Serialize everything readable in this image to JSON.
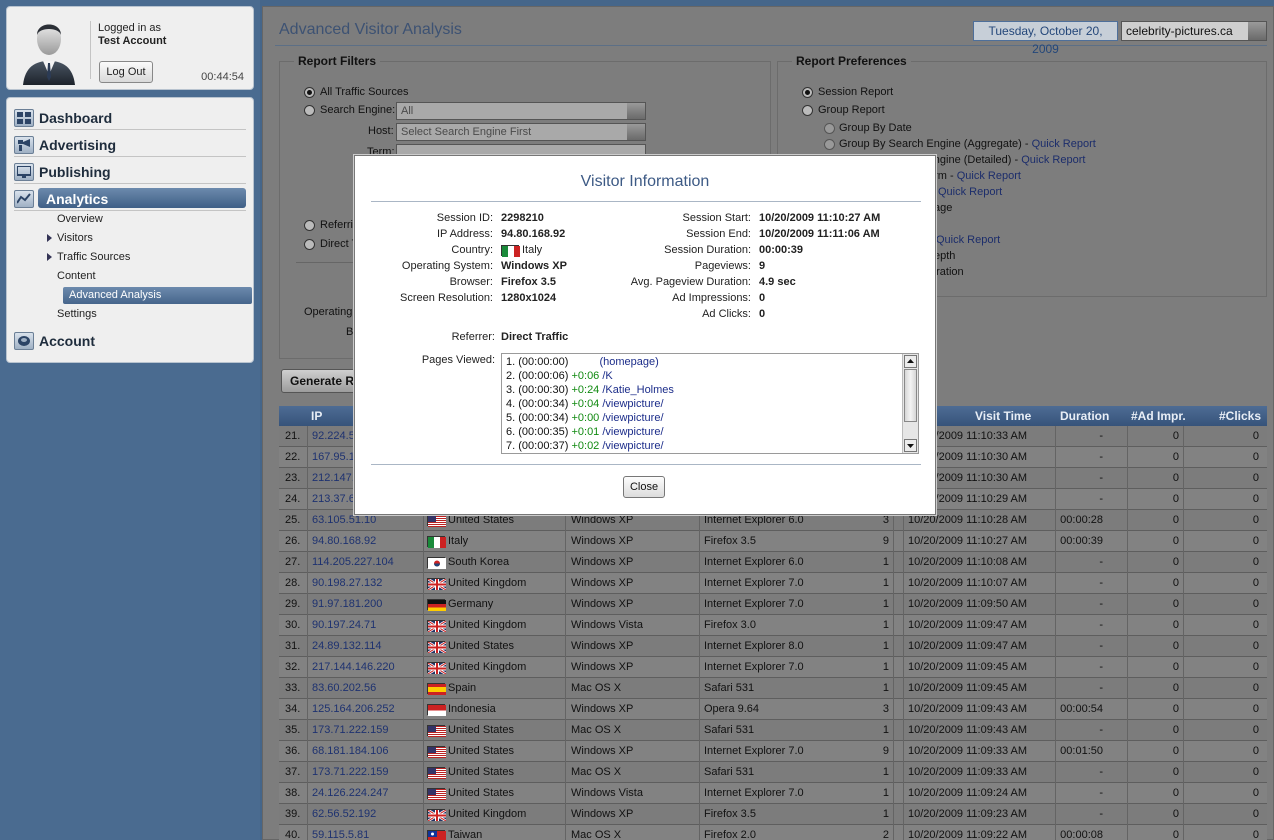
{
  "user": {
    "logged_in_label": "Logged in as",
    "account_name": "Test Account",
    "logout_label": "Log Out",
    "session_time": "00:44:54"
  },
  "nav": {
    "dashboard": "Dashboard",
    "advertising": "Advertising",
    "publishing": "Publishing",
    "analytics": "Analytics",
    "account": "Account",
    "analytics_sub": [
      "Overview",
      "Visitors",
      "Traffic Sources",
      "Content",
      "Advanced Analysis",
      "Settings"
    ]
  },
  "header": {
    "title": "Advanced Visitor Analysis",
    "date": "Tuesday, October 20, 2009",
    "site": "celebrity-pictures.ca"
  },
  "filters": {
    "legend": "Report Filters",
    "all_traffic": "All Traffic Sources",
    "search_engine": "Search Engine:",
    "search_engine_value": "All",
    "host_label": "Host:",
    "host_placeholder": "Select Search Engine First",
    "term_label": "Term:",
    "referrer_partial": "Referri",
    "direct_partial": "Direct T",
    "os_partial": "Operating",
    "b_partial": "B"
  },
  "prefs": {
    "legend": "Report Preferences",
    "session_report": "Session Report",
    "group_report": "Group Report",
    "group_by_date": "Group By Date",
    "group_by_se_agg": "Group By Search Engine (Aggregate) -",
    "group_by_se_det_partial": "Group By Search Engine (Detailed) -",
    "quick_report": "Quick Report",
    "term_partial": "erm -",
    "age_partial": "age",
    "depth_partial": "epth",
    "duration_partial": "uration"
  },
  "generate_label": "Generate Re",
  "table": {
    "headers": {
      "ip": "IP",
      "visit_time": "Visit Time",
      "duration": "Duration",
      "ad_impr": "#Ad Impr.",
      "clicks": "#Clicks"
    },
    "rows": [
      {
        "n": "21.",
        "ip": "92.224.5",
        "country": "",
        "flag": "",
        "os": "",
        "browser": "",
        "pv": "",
        "time": "10/20/2009 11:10:33 AM",
        "dur": "-",
        "imp": "0",
        "clk": "0"
      },
      {
        "n": "22.",
        "ip": "167.95.1",
        "country": "",
        "flag": "",
        "os": "",
        "browser": "",
        "pv": "",
        "time": "10/20/2009 11:10:30 AM",
        "dur": "-",
        "imp": "0",
        "clk": "0"
      },
      {
        "n": "23.",
        "ip": "212.147.",
        "country": "",
        "flag": "",
        "os": "",
        "browser": "",
        "pv": "",
        "time": "10/20/2009 11:10:30 AM",
        "dur": "-",
        "imp": "0",
        "clk": "0"
      },
      {
        "n": "24.",
        "ip": "213.37.6",
        "country": "",
        "flag": "",
        "os": "",
        "browser": "",
        "pv": "",
        "time": "10/20/2009 11:10:29 AM",
        "dur": "-",
        "imp": "0",
        "clk": "0"
      },
      {
        "n": "25.",
        "ip": "63.105.51.10",
        "country": "United States",
        "flag": "us",
        "os": "Windows XP",
        "browser": "Internet Explorer 6.0",
        "pv": "3",
        "time": "10/20/2009 11:10:28 AM",
        "dur": "00:00:28",
        "imp": "0",
        "clk": "0"
      },
      {
        "n": "26.",
        "ip": "94.80.168.92",
        "country": "Italy",
        "flag": "it",
        "os": "Windows XP",
        "browser": "Firefox 3.5",
        "pv": "9",
        "time": "10/20/2009 11:10:27 AM",
        "dur": "00:00:39",
        "imp": "0",
        "clk": "0"
      },
      {
        "n": "27.",
        "ip": "114.205.227.104",
        "country": "South Korea",
        "flag": "kr",
        "os": "Windows XP",
        "browser": "Internet Explorer 6.0",
        "pv": "1",
        "time": "10/20/2009 11:10:08 AM",
        "dur": "-",
        "imp": "0",
        "clk": "0"
      },
      {
        "n": "28.",
        "ip": "90.198.27.132",
        "country": "United Kingdom",
        "flag": "uk",
        "os": "Windows XP",
        "browser": "Internet Explorer 7.0",
        "pv": "1",
        "time": "10/20/2009 11:10:07 AM",
        "dur": "-",
        "imp": "0",
        "clk": "0"
      },
      {
        "n": "29.",
        "ip": "91.97.181.200",
        "country": "Germany",
        "flag": "de",
        "os": "Windows XP",
        "browser": "Internet Explorer 7.0",
        "pv": "1",
        "time": "10/20/2009 11:09:50 AM",
        "dur": "-",
        "imp": "0",
        "clk": "0"
      },
      {
        "n": "30.",
        "ip": "90.197.24.71",
        "country": "United Kingdom",
        "flag": "uk",
        "os": "Windows Vista",
        "browser": "Firefox 3.0",
        "pv": "1",
        "time": "10/20/2009 11:09:47 AM",
        "dur": "-",
        "imp": "0",
        "clk": "0"
      },
      {
        "n": "31.",
        "ip": "24.89.132.114",
        "country": "United States",
        "flag": "uk",
        "os": "Windows XP",
        "browser": "Internet Explorer 8.0",
        "pv": "1",
        "time": "10/20/2009 11:09:47 AM",
        "dur": "-",
        "imp": "0",
        "clk": "0"
      },
      {
        "n": "32.",
        "ip": "217.144.146.220",
        "country": "United Kingdom",
        "flag": "uk",
        "os": "Windows XP",
        "browser": "Internet Explorer 7.0",
        "pv": "1",
        "time": "10/20/2009 11:09:45 AM",
        "dur": "-",
        "imp": "0",
        "clk": "0"
      },
      {
        "n": "33.",
        "ip": "83.60.202.56",
        "country": "Spain",
        "flag": "es",
        "os": "Mac OS X",
        "browser": "Safari 531",
        "pv": "1",
        "time": "10/20/2009 11:09:45 AM",
        "dur": "-",
        "imp": "0",
        "clk": "0"
      },
      {
        "n": "34.",
        "ip": "125.164.206.252",
        "country": "Indonesia",
        "flag": "id",
        "os": "Windows XP",
        "browser": "Opera 9.64",
        "pv": "3",
        "time": "10/20/2009 11:09:43 AM",
        "dur": "00:00:54",
        "imp": "0",
        "clk": "0"
      },
      {
        "n": "35.",
        "ip": "173.71.222.159",
        "country": "United States",
        "flag": "us",
        "os": "Mac OS X",
        "browser": "Safari 531",
        "pv": "1",
        "time": "10/20/2009 11:09:43 AM",
        "dur": "-",
        "imp": "0",
        "clk": "0"
      },
      {
        "n": "36.",
        "ip": "68.181.184.106",
        "country": "United States",
        "flag": "us",
        "os": "Windows XP",
        "browser": "Internet Explorer 7.0",
        "pv": "9",
        "time": "10/20/2009 11:09:33 AM",
        "dur": "00:01:50",
        "imp": "0",
        "clk": "0"
      },
      {
        "n": "37.",
        "ip": "173.71.222.159",
        "country": "United States",
        "flag": "us",
        "os": "Mac OS X",
        "browser": "Safari 531",
        "pv": "1",
        "time": "10/20/2009 11:09:33 AM",
        "dur": "-",
        "imp": "0",
        "clk": "0"
      },
      {
        "n": "38.",
        "ip": "24.126.224.247",
        "country": "United States",
        "flag": "us",
        "os": "Windows Vista",
        "browser": "Internet Explorer 7.0",
        "pv": "1",
        "time": "10/20/2009 11:09:24 AM",
        "dur": "-",
        "imp": "0",
        "clk": "0"
      },
      {
        "n": "39.",
        "ip": "62.56.52.192",
        "country": "United Kingdom",
        "flag": "uk",
        "os": "Windows XP",
        "browser": "Firefox 3.5",
        "pv": "1",
        "time": "10/20/2009 11:09:23 AM",
        "dur": "-",
        "imp": "0",
        "clk": "0"
      },
      {
        "n": "40.",
        "ip": "59.115.5.81",
        "country": "Taiwan",
        "flag": "tw",
        "os": "Mac OS X",
        "browser": "Firefox 2.0",
        "pv": "2",
        "time": "10/20/2009 11:09:22 AM",
        "dur": "00:00:08",
        "imp": "0",
        "clk": "0"
      }
    ]
  },
  "modal": {
    "title": "Visitor Information",
    "left": [
      {
        "k": "Session ID:",
        "v": "2298210"
      },
      {
        "k": "IP Address:",
        "v": "94.80.168.92"
      },
      {
        "k": "Country:",
        "v": "Italy"
      },
      {
        "k": "Operating System:",
        "v": "Windows XP"
      },
      {
        "k": "Browser:",
        "v": "Firefox 3.5"
      },
      {
        "k": "Screen Resolution:",
        "v": "1280x1024"
      }
    ],
    "right": [
      {
        "k": "Session Start:",
        "v": "10/20/2009 11:10:27 AM"
      },
      {
        "k": "Session End:",
        "v": "10/20/2009 11:11:06 AM"
      },
      {
        "k": "Session Duration:",
        "v": "00:00:39"
      },
      {
        "k": "Pageviews:",
        "v": "9"
      },
      {
        "k": "Avg. Pageview Duration:",
        "v": "4.9 sec"
      },
      {
        "k": "Ad Impressions:",
        "v": "0"
      },
      {
        "k": "Ad Clicks:",
        "v": "0"
      }
    ],
    "referrer_label": "Referrer:",
    "referrer_value": "Direct Traffic",
    "pages_label": "Pages Viewed:",
    "pages": [
      {
        "n": "1. (",
        "t": "00:00:00",
        "c": ")",
        "d": "",
        "u": "(homepage)"
      },
      {
        "n": "2. (",
        "t": "00:00:06",
        "c": ")",
        "d": "+0:06",
        "u": "/K"
      },
      {
        "n": "3. (",
        "t": "00:00:30",
        "c": ")",
        "d": "+0:24",
        "u": "/Katie_Holmes"
      },
      {
        "n": "4. (",
        "t": "00:00:34",
        "c": ")",
        "d": "+0:04",
        "u": "/viewpicture/"
      },
      {
        "n": "5. (",
        "t": "00:00:34",
        "c": ")",
        "d": "+0:00",
        "u": "/viewpicture/"
      },
      {
        "n": "6. (",
        "t": "00:00:35",
        "c": ")",
        "d": "+0:01",
        "u": "/viewpicture/"
      },
      {
        "n": "7. (",
        "t": "00:00:37",
        "c": ")",
        "d": "+0:02",
        "u": "/viewpicture/"
      }
    ],
    "close_label": "Close"
  }
}
